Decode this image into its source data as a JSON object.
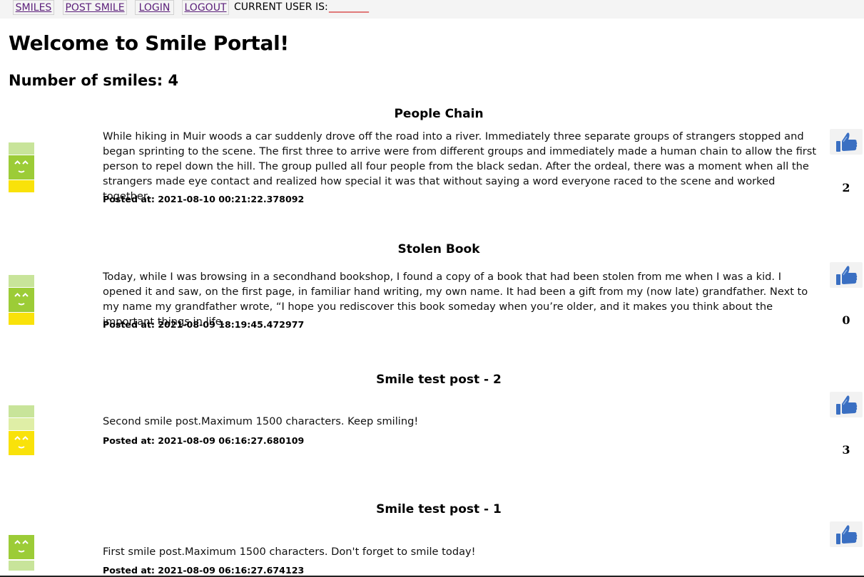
{
  "nav": {
    "smiles": "SMILES",
    "post_smile": "POST SMILE",
    "login": "LOGIN",
    "logout": "LOGOUT",
    "current_user_label": "CURRENT USER IS:",
    "current_user_value": "________"
  },
  "heading": "Welcome to Smile Portal!",
  "smile_count": "Number of smiles: 4",
  "colors": {
    "face_dark": "#9ccc37",
    "face_light": "#c8e49a",
    "pale_green": "#dfeea6",
    "yellow": "#f9e20a",
    "link": "#5b1f7a",
    "user_value": "#cc0000",
    "like_icon": "#3a6fc2"
  },
  "posts": [
    {
      "title": "People Chain",
      "body": "While hiking in Muir woods a car suddenly drove off the road into a river. Immediately three separate groups of strangers stopped and began sprinting to the scene. The first three to arrive were from different groups and immediately made a human chain to allow the first person to repel down the hill. The group pulled all four people from the black sedan. After the ordeal, there was a moment when all the strangers made eye contact and realized how special it was that without saying a word everyone raced to the scene and worked together.",
      "posted_at": "Posted at: 2021-08-10 00:21:22.378092",
      "likes": "2",
      "smile_level": 3
    },
    {
      "title": "Stolen Book",
      "body": "Today, while I was browsing in a secondhand bookshop, I found a copy of a book that had been stolen from me when I was a kid. I opened it and saw, on the first page, in familiar hand writing, my own name. It had been a gift from my (now late) grandfather. Next to my name my grandfather wrote, “I hope you rediscover this book someday when you’re older, and it makes you think about the important things in life.",
      "posted_at": "Posted at: 2021-08-09 18:19:45.472977",
      "likes": "0",
      "smile_level": 3
    },
    {
      "title": "Smile test post - 2",
      "body": "Second smile post.Maximum 1500 characters. Keep smiling!",
      "posted_at": "Posted at: 2021-08-09 06:16:27.680109",
      "likes": "3",
      "smile_level": 1
    },
    {
      "title": "Smile test post - 1",
      "body": "First smile post.Maximum 1500 characters. Don't forget to smile today!",
      "posted_at": "Posted at: 2021-08-09 06:16:27.674123",
      "likes": "",
      "smile_level": 4
    }
  ]
}
